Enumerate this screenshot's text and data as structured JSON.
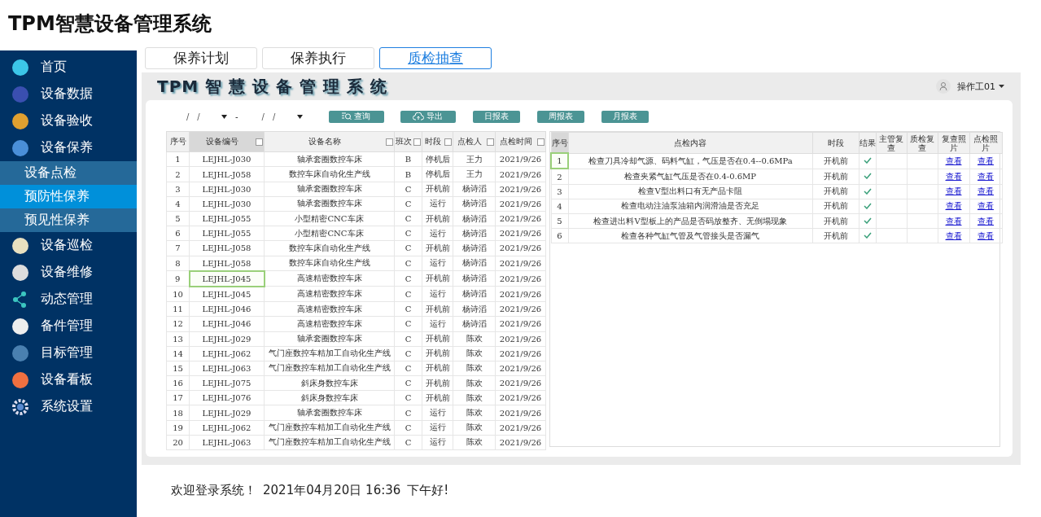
{
  "app_title": "TPM智慧设备管理系统",
  "sidebar": {
    "items": [
      {
        "label": "首页",
        "selected": false
      },
      {
        "label": "设备数据",
        "selected": false
      },
      {
        "label": "设备验收",
        "selected": false
      },
      {
        "label": "设备保养",
        "selected": false,
        "expanded": true,
        "children": [
          {
            "label": "设备点检",
            "selected": false
          },
          {
            "label": "预防性保养",
            "selected": true
          },
          {
            "label": "预见性保养",
            "selected": false
          }
        ]
      },
      {
        "label": "设备巡检",
        "selected": false
      },
      {
        "label": "设备维修",
        "selected": false
      },
      {
        "label": "动态管理",
        "selected": false
      },
      {
        "label": "备件管理",
        "selected": false
      },
      {
        "label": "目标管理",
        "selected": false
      },
      {
        "label": "设备看板",
        "selected": false
      },
      {
        "label": "系统设置",
        "selected": false
      }
    ]
  },
  "tabs": [
    {
      "label": "保养计划",
      "selected": false
    },
    {
      "label": "保养执行",
      "selected": false
    },
    {
      "label": "质检抽查",
      "selected": true
    }
  ],
  "banner_title": "TPM 智 慧 设 备 管 理 系 统",
  "user": {
    "name": "操作工01"
  },
  "filters": {
    "date_from": {
      "placeholder": "___/__/__"
    },
    "separator": "-",
    "date_to": {
      "placeholder": "___/__/__"
    }
  },
  "buttons": [
    {
      "label": "查询",
      "kind": "search"
    },
    {
      "label": "导出",
      "kind": "export"
    },
    {
      "label": "日报表",
      "kind": "plain"
    },
    {
      "label": "周报表",
      "kind": "plain"
    },
    {
      "label": "月报表",
      "kind": "plain"
    }
  ],
  "left_table": {
    "columns": [
      {
        "label": "序号",
        "filter": false,
        "selected": false
      },
      {
        "label": "设备编号",
        "filter": true,
        "selected": true
      },
      {
        "label": "设备名称",
        "filter": true,
        "selected": false
      },
      {
        "label": "班次",
        "filter": true,
        "selected": false
      },
      {
        "label": "时段",
        "filter": true,
        "selected": false
      },
      {
        "label": "点检人",
        "filter": true,
        "selected": false
      },
      {
        "label": "点检时间",
        "filter": true,
        "selected": false
      }
    ],
    "rows": [
      {
        "cells": [
          "1",
          "LEJHL-J030",
          "轴承套圈数控车床",
          "B",
          "停机后",
          "王力",
          "2021/9/26"
        ],
        "selected": false
      },
      {
        "cells": [
          "2",
          "LEJHL-J058",
          "数控车床自动化生产线",
          "B",
          "停机后",
          "王力",
          "2021/9/26"
        ],
        "selected": false
      },
      {
        "cells": [
          "3",
          "LEJHL-J030",
          "轴承套圈数控车床",
          "C",
          "开机前",
          "杨诗滔",
          "2021/9/26"
        ],
        "selected": false
      },
      {
        "cells": [
          "4",
          "LEJHL-J030",
          "轴承套圈数控车床",
          "C",
          "运行",
          "杨诗滔",
          "2021/9/26"
        ],
        "selected": false
      },
      {
        "cells": [
          "5",
          "LEJHL-J055",
          "小型精密CNC车床",
          "C",
          "开机前",
          "杨诗滔",
          "2021/9/26"
        ],
        "selected": false
      },
      {
        "cells": [
          "6",
          "LEJHL-J055",
          "小型精密CNC车床",
          "C",
          "运行",
          "杨诗滔",
          "2021/9/26"
        ],
        "selected": false
      },
      {
        "cells": [
          "7",
          "LEJHL-J058",
          "数控车床自动化生产线",
          "C",
          "开机前",
          "杨诗滔",
          "2021/9/26"
        ],
        "selected": false
      },
      {
        "cells": [
          "8",
          "LEJHL-J058",
          "数控车床自动化生产线",
          "C",
          "运行",
          "杨诗滔",
          "2021/9/26"
        ],
        "selected": false
      },
      {
        "cells": [
          "9",
          "LEJHL-J045",
          "高速精密数控车床",
          "C",
          "开机前",
          "杨诗滔",
          "2021/9/26"
        ],
        "selected": true
      },
      {
        "cells": [
          "10",
          "LEJHL-J045",
          "高速精密数控车床",
          "C",
          "运行",
          "杨诗滔",
          "2021/9/26"
        ],
        "selected": false
      },
      {
        "cells": [
          "11",
          "LEJHL-J046",
          "高速精密数控车床",
          "C",
          "开机前",
          "杨诗滔",
          "2021/9/26"
        ],
        "selected": false
      },
      {
        "cells": [
          "12",
          "LEJHL-J046",
          "高速精密数控车床",
          "C",
          "运行",
          "杨诗滔",
          "2021/9/26"
        ],
        "selected": false
      },
      {
        "cells": [
          "13",
          "LEJHL-J029",
          "轴承套圈数控车床",
          "C",
          "开机前",
          "陈欢",
          "2021/9/26"
        ],
        "selected": false
      },
      {
        "cells": [
          "14",
          "LEJHL-J062",
          "气门座数控车精加工自动化生产线",
          "C",
          "开机前",
          "陈欢",
          "2021/9/26"
        ],
        "selected": false
      },
      {
        "cells": [
          "15",
          "LEJHL-J063",
          "气门座数控车精加工自动化生产线",
          "C",
          "开机前",
          "陈欢",
          "2021/9/26"
        ],
        "selected": false
      },
      {
        "cells": [
          "16",
          "LEJHL-J075",
          "斜床身数控车床",
          "C",
          "开机前",
          "陈欢",
          "2021/9/26"
        ],
        "selected": false
      },
      {
        "cells": [
          "17",
          "LEJHL-J076",
          "斜床身数控车床",
          "C",
          "开机前",
          "陈欢",
          "2021/9/26"
        ],
        "selected": false
      },
      {
        "cells": [
          "18",
          "LEJHL-J029",
          "轴承套圈数控车床",
          "C",
          "运行",
          "陈欢",
          "2021/9/26"
        ],
        "selected": false
      },
      {
        "cells": [
          "19",
          "LEJHL-J062",
          "气门座数控车精加工自动化生产线",
          "C",
          "运行",
          "陈欢",
          "2021/9/26"
        ],
        "selected": false
      },
      {
        "cells": [
          "20",
          "LEJHL-J063",
          "气门座数控车精加工自动化生产线",
          "C",
          "运行",
          "陈欢",
          "2021/9/26"
        ],
        "selected": false
      }
    ]
  },
  "right_table": {
    "columns": [
      "序号",
      "点检内容",
      "时段",
      "结果",
      "主管复查",
      "质检复查",
      "复查照片",
      "点检照片"
    ],
    "rows": [
      {
        "index": "1",
        "content": "检查刀具冷却气源、码料气缸，气压是否在0.4--0.6MPa",
        "period": "开机前",
        "passed": true,
        "review_photo": "查看",
        "check_photo": "查看",
        "selected": true
      },
      {
        "index": "2",
        "content": "检查夹紧气缸气压是否在0.4-0.6MP",
        "period": "开机前",
        "passed": true,
        "review_photo": "查看",
        "check_photo": "查看",
        "selected": false
      },
      {
        "index": "3",
        "content": "检查V型出料口有无产品卡阻",
        "period": "开机前",
        "passed": true,
        "review_photo": "查看",
        "check_photo": "查看",
        "selected": false
      },
      {
        "index": "4",
        "content": "检查电动注油泵油箱内润滑油是否充足",
        "period": "开机前",
        "passed": true,
        "review_photo": "查看",
        "check_photo": "查看",
        "selected": false
      },
      {
        "index": "5",
        "content": "检查进出料V型板上的产品是否码放整齐、无倒塌现象",
        "period": "开机前",
        "passed": true,
        "review_photo": "查看",
        "check_photo": "查看",
        "selected": false
      },
      {
        "index": "6",
        "content": "检查各种气缸气管及气管接头是否漏气",
        "period": "开机前",
        "passed": true,
        "review_photo": "查看",
        "check_photo": "查看",
        "selected": false
      }
    ]
  },
  "status_bar": {
    "welcome": "欢迎登录系统！",
    "datetime": "2021年04月20日 16:36",
    "greeting": "下午好!"
  }
}
